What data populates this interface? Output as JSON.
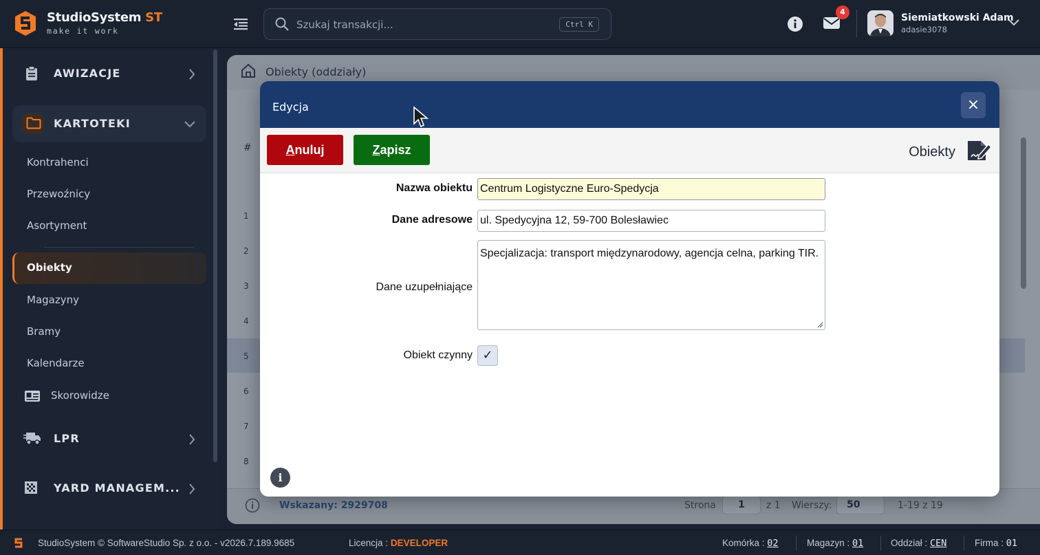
{
  "brand": {
    "name": "StudioSystem",
    "suffix": "ST",
    "tagline": "make it work"
  },
  "search": {
    "placeholder": "Szukaj transakcji...",
    "shortcut": "Ctrl K"
  },
  "notifications": {
    "count": "4"
  },
  "user": {
    "name": "Siemiatkowski Adam",
    "login": "adasie3078"
  },
  "sidebar": {
    "sections": [
      {
        "label": "AWIZACJE",
        "icon": "clipboard-icon"
      },
      {
        "label": "KARTOTEKI",
        "icon": "folder-icon"
      },
      {
        "label": "LPR",
        "icon": "truck-icon"
      },
      {
        "label": "YARD MANAGEM...",
        "icon": "grid-icon"
      }
    ],
    "kartoteki_items": [
      "Kontrahenci",
      "Przewoźnicy",
      "Asortyment",
      "Obiekty",
      "Magazyny",
      "Bramy",
      "Kalendarze",
      "Skorowidze"
    ],
    "selected": "Obiekty"
  },
  "main": {
    "breadcrumb": "Obiekty (oddziały)",
    "row_numbers": [
      "1",
      "2",
      "3",
      "4",
      "5",
      "6",
      "7",
      "8"
    ],
    "hash_header": "#",
    "selected_info": "Wskazany: 2929708",
    "pagination": {
      "page_label": "Strona",
      "page": "1",
      "of_label": "z 1",
      "rows_label": "Wierszy:",
      "rows": "50",
      "range": "1-19 z 19"
    }
  },
  "modal": {
    "title": "Edycja",
    "close_label": "×",
    "cancel_label_first": "A",
    "cancel_label_rest": "nuluj",
    "save_label_first": "Z",
    "save_label_rest": "apisz",
    "context_label": "Obiekty",
    "fields": {
      "name_label": "Nazwa obiektu",
      "name_value": "Centrum Logistyczne Euro-Spedycja",
      "address_label": "Dane adresowe",
      "address_value": "ul. Spedycyjna 12, 59-700 Bolesławiec",
      "extra_label": "Dane uzupełniające",
      "extra_value": "Specjalizacja: transport międzynarodowy, agencja celna, parking TIR.",
      "active_label": "Obiekt czynny",
      "active_checked": true,
      "check_mark": "✓"
    },
    "info_label": "i"
  },
  "statusbar": {
    "copyright": "StudioSystem © SoftwareStudio Sp. z o.o. - v2026.7.189.9685",
    "license_label": "Licencja :",
    "license_value": "DEVELOPER",
    "cell_label": "Komórka :",
    "cell_value": "02",
    "warehouse_label": "Magazyn :",
    "warehouse_value": "01",
    "branch_label": "Oddział :",
    "branch_value": "CEN",
    "company_label": "Firma :",
    "company_value": "01"
  },
  "colors": {
    "accent": "#f07a26",
    "modal_header": "#1a3a6e",
    "cancel": "#b0060d",
    "save": "#0a6c10",
    "badge": "#e53935"
  }
}
